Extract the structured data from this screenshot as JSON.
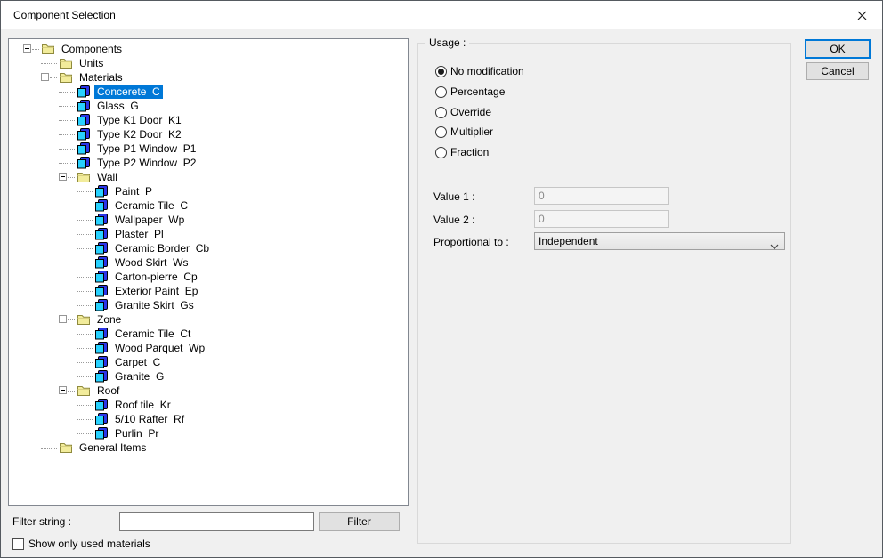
{
  "window": {
    "title": "Component Selection"
  },
  "tree": {
    "items": [
      {
        "label": "Components",
        "level": 0,
        "icon": "folder",
        "expandable": true
      },
      {
        "label": "Units",
        "level": 1,
        "icon": "folder",
        "expandable": false
      },
      {
        "label": "Materials",
        "level": 1,
        "icon": "folder",
        "expandable": true
      },
      {
        "label": "Concerete  C",
        "level": 2,
        "icon": "material",
        "expandable": false,
        "selected": true
      },
      {
        "label": "Glass  G",
        "level": 2,
        "icon": "material",
        "expandable": false
      },
      {
        "label": "Type K1 Door  K1",
        "level": 2,
        "icon": "material",
        "expandable": false
      },
      {
        "label": "Type K2 Door  K2",
        "level": 2,
        "icon": "material",
        "expandable": false
      },
      {
        "label": "Type P1 Window  P1",
        "level": 2,
        "icon": "material",
        "expandable": false
      },
      {
        "label": "Type P2 Window  P2",
        "level": 2,
        "icon": "material",
        "expandable": false
      },
      {
        "label": "Wall",
        "level": 2,
        "icon": "folder",
        "expandable": true
      },
      {
        "label": "Paint  P",
        "level": 3,
        "icon": "material",
        "expandable": false
      },
      {
        "label": "Ceramic Tile  C",
        "level": 3,
        "icon": "material",
        "expandable": false
      },
      {
        "label": "Wallpaper  Wp",
        "level": 3,
        "icon": "material",
        "expandable": false
      },
      {
        "label": "Plaster  Pl",
        "level": 3,
        "icon": "material",
        "expandable": false
      },
      {
        "label": "Ceramic Border  Cb",
        "level": 3,
        "icon": "material",
        "expandable": false
      },
      {
        "label": "Wood Skirt  Ws",
        "level": 3,
        "icon": "material",
        "expandable": false
      },
      {
        "label": "Carton-pierre  Cp",
        "level": 3,
        "icon": "material",
        "expandable": false
      },
      {
        "label": "Exterior Paint  Ep",
        "level": 3,
        "icon": "material",
        "expandable": false
      },
      {
        "label": "Granite Skirt  Gs",
        "level": 3,
        "icon": "material",
        "expandable": false
      },
      {
        "label": "Zone",
        "level": 2,
        "icon": "folder",
        "expandable": true
      },
      {
        "label": "Ceramic Tile  Ct",
        "level": 3,
        "icon": "material",
        "expandable": false
      },
      {
        "label": "Wood Parquet  Wp",
        "level": 3,
        "icon": "material",
        "expandable": false
      },
      {
        "label": "Carpet  C",
        "level": 3,
        "icon": "material",
        "expandable": false
      },
      {
        "label": "Granite  G",
        "level": 3,
        "icon": "material",
        "expandable": false
      },
      {
        "label": "Roof",
        "level": 2,
        "icon": "folder",
        "expandable": true
      },
      {
        "label": "Roof tile  Kr",
        "level": 3,
        "icon": "material",
        "expandable": false
      },
      {
        "label": "5/10 Rafter  Rf",
        "level": 3,
        "icon": "material",
        "expandable": false
      },
      {
        "label": "Purlin  Pr",
        "level": 3,
        "icon": "material",
        "expandable": false
      },
      {
        "label": "General Items",
        "level": 1,
        "icon": "folder",
        "expandable": false
      }
    ]
  },
  "filter": {
    "label": "Filter string :",
    "value": "",
    "button_label": "Filter"
  },
  "show_only_used": {
    "label": "Show only used materials",
    "checked": false
  },
  "usage": {
    "legend": "Usage :",
    "options": [
      {
        "label": "No modification",
        "selected": true
      },
      {
        "label": "Percentage",
        "selected": false
      },
      {
        "label": "Override",
        "selected": false
      },
      {
        "label": "Multiplier",
        "selected": false
      },
      {
        "label": "Fraction",
        "selected": false
      }
    ],
    "value1_label": "Value 1 :",
    "value1": "0",
    "value2_label": "Value 2 :",
    "value2": "0",
    "proportional_label": "Proportional to :",
    "proportional_value": "Independent"
  },
  "buttons": {
    "ok": "OK",
    "cancel": "Cancel"
  },
  "colors": {
    "selection": "#0078d7",
    "folder": "#f2ec9b",
    "material_front": "#27d1ff",
    "material_back": "#2b35e8"
  }
}
